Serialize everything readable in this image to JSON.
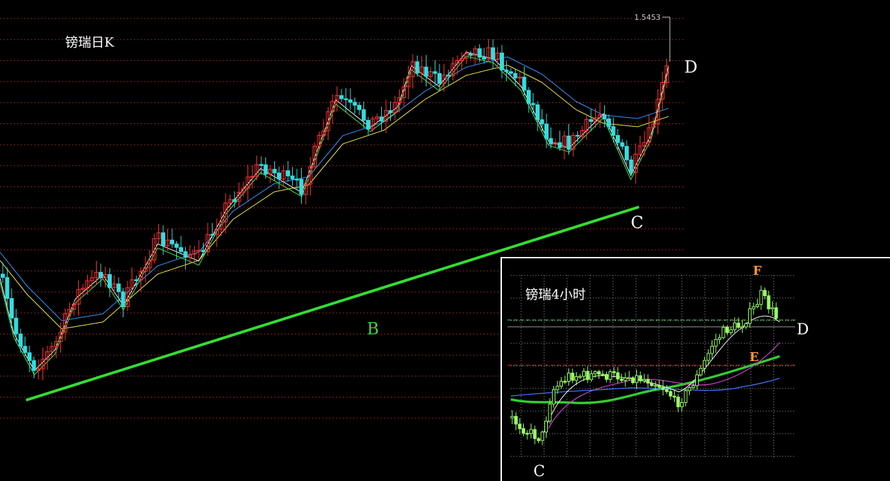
{
  "main": {
    "title": "镑瑞日K",
    "price_label": "1.5453",
    "labels": {
      "B": "B",
      "C": "C",
      "D": "D"
    }
  },
  "inset": {
    "title": "镑瑞4小时",
    "labels": {
      "C": "C",
      "D": "D",
      "E": "E",
      "F": "F"
    }
  },
  "colors": {
    "background": "#000000",
    "up_candle": "#ff3333",
    "down_candle": "#33dddd",
    "trendline": "#33dd33",
    "grid": "#8a2020",
    "inset_up": "#99ff66",
    "inset_trendline": "#33cc33",
    "inset_purple": "#cc44cc",
    "inset_blue": "#4477ff",
    "label_orange": "#ff9a3c"
  },
  "chart_data": [
    {
      "type": "candlestick",
      "title": "镑瑞日K",
      "annotations": [
        "B",
        "C",
        "D"
      ],
      "last_price": 1.5453,
      "moving_averages": [
        "yellow",
        "blue",
        "green",
        "white"
      ],
      "trend": "rising trendline under lows from start to C"
    },
    {
      "type": "candlestick",
      "title": "镑瑞4小时",
      "annotations": [
        "C",
        "D",
        "E",
        "F"
      ],
      "moving_averages": [
        "green",
        "purple",
        "blue",
        "white"
      ]
    }
  ]
}
